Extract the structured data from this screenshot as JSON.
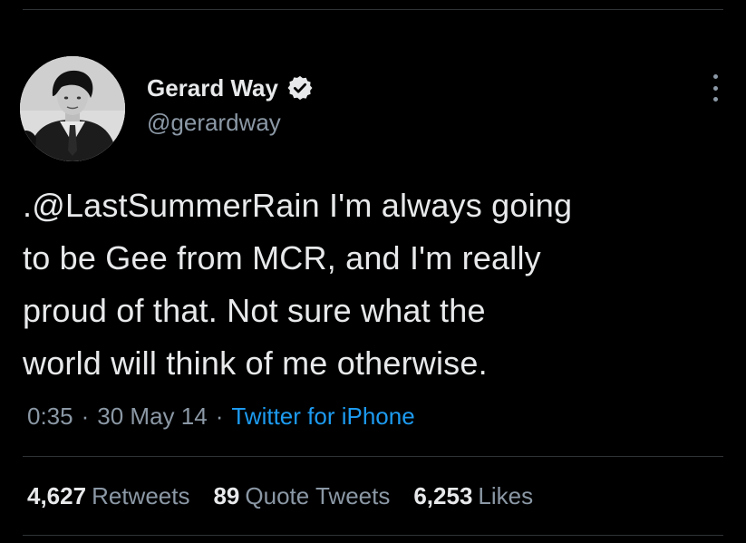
{
  "author": {
    "name": "Gerard Way",
    "handle": "@gerardway",
    "verified": true
  },
  "tweet": {
    "line1": ".@LastSummerRain I'm always going",
    "line2": "to be Gee from MCR, and I'm really",
    "line3": "proud of that. Not sure what the",
    "line4": "world will think of me otherwise."
  },
  "meta": {
    "time": "0:35",
    "date": "30 May 14",
    "source": "Twitter for iPhone",
    "separator": "·"
  },
  "stats": {
    "retweets_count": "4,627",
    "retweets_label": "Retweets",
    "quotes_count": "89",
    "quotes_label": "Quote Tweets",
    "likes_count": "6,253",
    "likes_label": "Likes"
  },
  "colors": {
    "background": "#000000",
    "text": "#e7e9ea",
    "secondary": "#8b98a5",
    "link": "#1d9bf0",
    "verified_badge": "#e7e9ea",
    "divider": "#2f3336"
  },
  "icons": {
    "verified": "verified-badge-icon",
    "more": "more-options-icon"
  }
}
